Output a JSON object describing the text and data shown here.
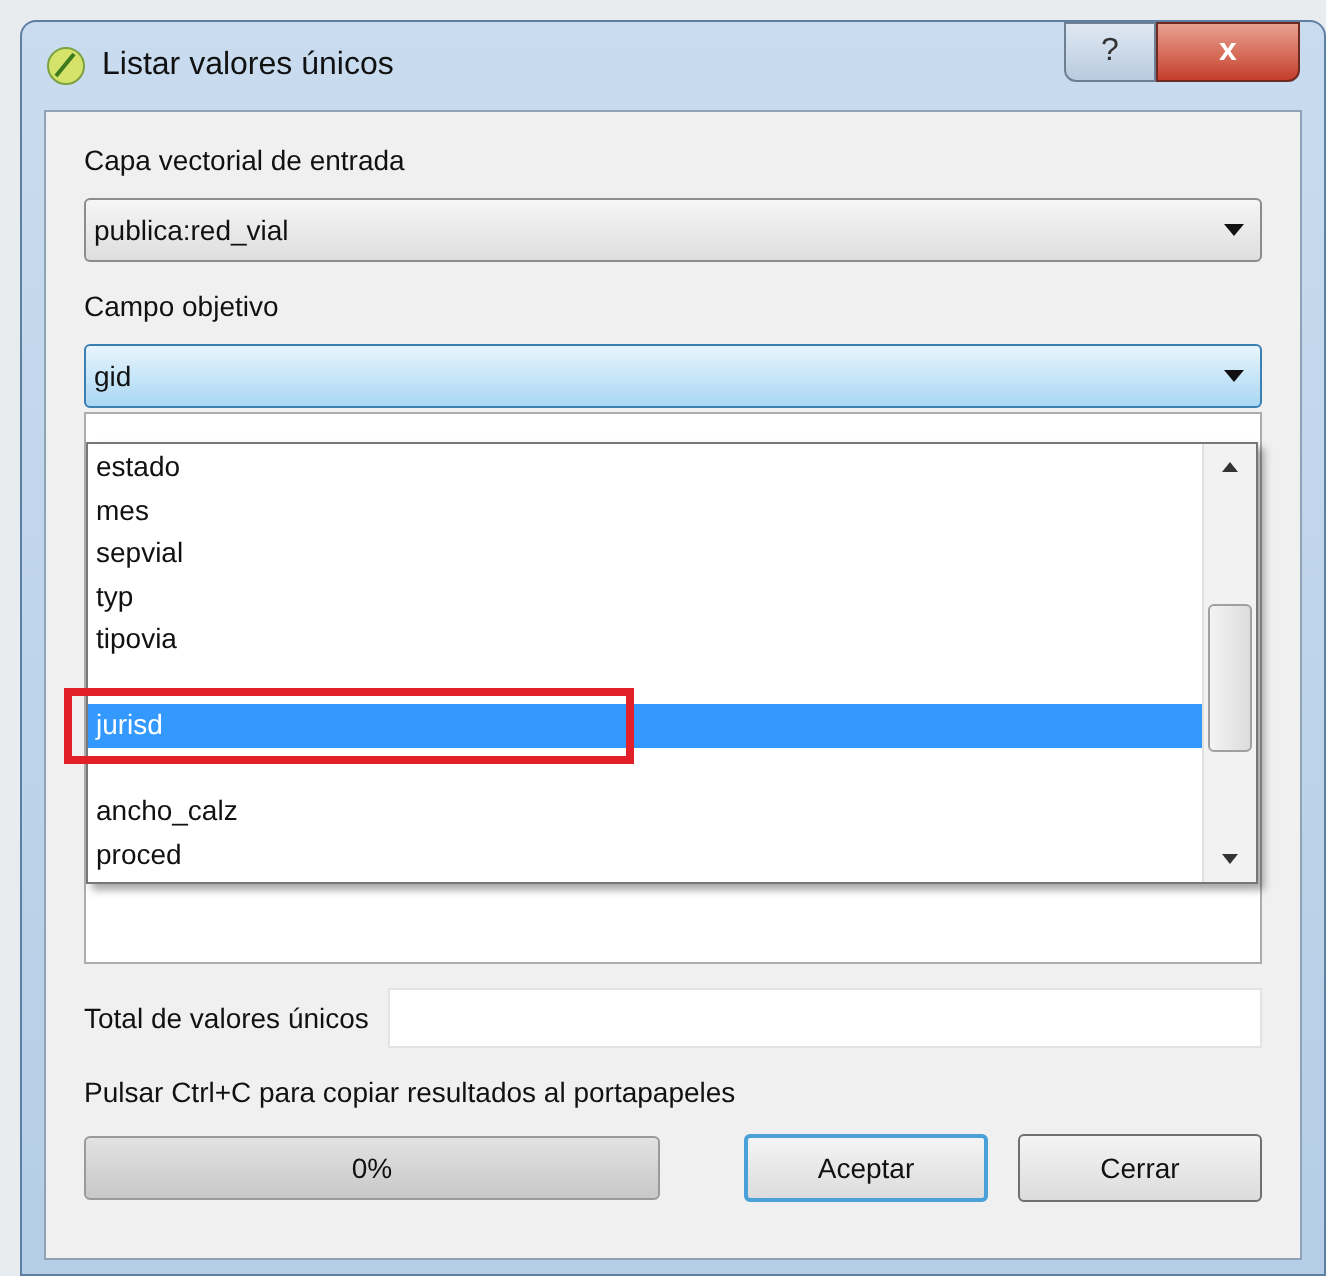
{
  "window": {
    "title": "Listar valores únicos",
    "buttons": [
      {
        "kind": "help",
        "label": "?"
      },
      {
        "kind": "close",
        "label": "x"
      }
    ]
  },
  "input_layer": {
    "label": "Capa vectorial de entrada",
    "value": "publica:red_vial"
  },
  "target_field": {
    "label": "Campo objetivo",
    "value": "gid",
    "expanded": true,
    "options": [
      {
        "label": "estado",
        "selected": false
      },
      {
        "label": "mes",
        "selected": false
      },
      {
        "label": "sepvial",
        "selected": false
      },
      {
        "label": "typ",
        "selected": false
      },
      {
        "label": "tipovia",
        "selected": false
      },
      {
        "label": "jurisd",
        "selected": true,
        "highlighted": true
      },
      {
        "label": "ancho_calz",
        "selected": false
      },
      {
        "label": "proced",
        "selected": false
      }
    ]
  },
  "total": {
    "label": "Total de valores únicos"
  },
  "hint": "Pulsar Ctrl+C para copiar resultados al portapapeles",
  "progress": {
    "text": "0%"
  },
  "buttons": [
    {
      "label": "Aceptar",
      "default": true
    },
    {
      "label": "Cerrar",
      "default": false
    }
  ]
}
